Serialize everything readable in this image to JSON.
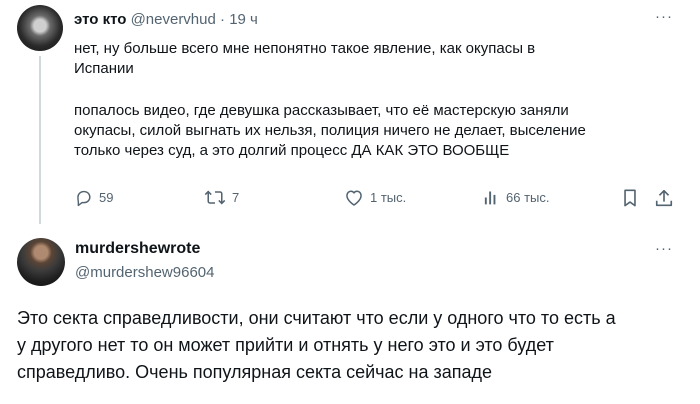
{
  "tweet": {
    "author_name": "это кто",
    "handle": "@nevervhud",
    "separator": "·",
    "time": "19 ч",
    "more": "···",
    "text_lines": [
      "нет, ну больше всего мне непонятно такое явление, как окупасы в",
      "Испании"
    ],
    "text_lines_2": [
      "попалось видео, где девушка рассказывает, что её мастерскую заняли",
      "окупасы, силой выгнать их нельзя, полиция ничего не делает, выселение",
      "только через суд, а это долгий процесс ДА КАК ЭТО ВООБЩЕ"
    ],
    "actions": {
      "replies": "59",
      "retweets": "7",
      "likes": "1 тыс.",
      "views": "66 тыс."
    }
  },
  "reply": {
    "author_name": "murdershewrote",
    "handle": "@murdershew96604",
    "more": "···",
    "text_lines": [
      "Это секта справедливости, они считают что если у одного что то есть а",
      "у другого нет то он может прийти и отнять у него это и это будет",
      "справедливо. Очень популярная секта сейчас на западе"
    ]
  }
}
